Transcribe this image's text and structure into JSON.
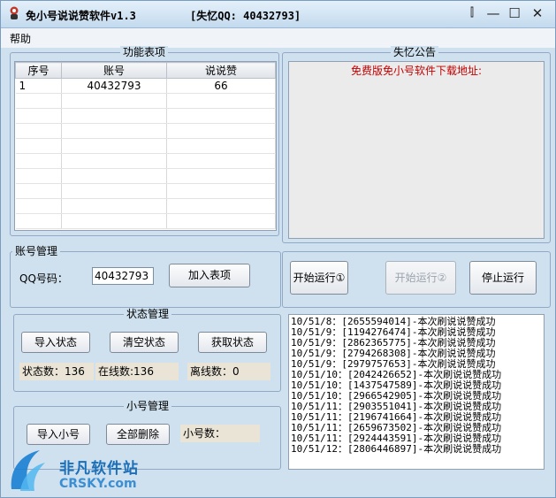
{
  "window": {
    "title": "免小号说说赞软件v1.3",
    "qq_tag": "[失忆QQ: 40432793]",
    "buttons": {
      "minimize": "—",
      "maximize": "☐",
      "close": "✕",
      "extra": "⫿"
    }
  },
  "menu": {
    "help": "帮助"
  },
  "function_table": {
    "legend": "功能表项",
    "columns": [
      "序号",
      "账号",
      "说说赞"
    ],
    "rows": [
      {
        "index": "1",
        "account": "40432793",
        "likes": "66"
      }
    ]
  },
  "notice": {
    "legend": "失忆公告",
    "text": "免费版免小号软件下载地址:"
  },
  "account_mgmt": {
    "legend": "账号管理",
    "qq_label": "QQ号码：",
    "qq_value": "40432793",
    "add_button": "加入表项"
  },
  "run_controls": {
    "start1": "开始运行①",
    "start2": "开始运行②",
    "stop": "停止运行"
  },
  "status_mgmt": {
    "legend": "状态管理",
    "import_button": "导入状态",
    "clear_button": "清空状态",
    "fetch_button": "获取状态",
    "status_count": "状态数：136",
    "online_count": "在线数:136",
    "offline_count": "离线数：0"
  },
  "small_account": {
    "legend": "小号管理",
    "import_button": "导入小号",
    "delete_all_button": "全部删除",
    "count_label": "小号数："
  },
  "log": [
    "10/51/8：[2655594014]-本次刷说说赞成功",
    "10/51/9：[1194276474]-本次刷说说赞成功",
    "10/51/9：[2862365775]-本次刷说说赞成功",
    "10/51/9：[2794268308]-本次刷说说赞成功",
    "10/51/9：[2979757653]-本次刷说说赞成功",
    "10/51/10：[2042426652]-本次刷说说赞成功",
    "10/51/10：[1437547589]-本次刷说说赞成功",
    "10/51/10：[2966542905]-本次刷说说赞成功",
    "10/51/11：[2903551041]-本次刷说说赞成功",
    "10/51/11：[2196741664]-本次刷说说赞成功",
    "10/51/11：[2659673502]-本次刷说说赞成功",
    "10/51/11：[2924443591]-本次刷说说赞成功",
    "10/51/12：[2806446897]-本次刷说说赞成功"
  ],
  "watermark": {
    "cn": "非凡软件站",
    "en": "CRSKY.com"
  },
  "colors": {
    "notice_text": "#c00000",
    "panel_bg": "#cfe0ee"
  }
}
